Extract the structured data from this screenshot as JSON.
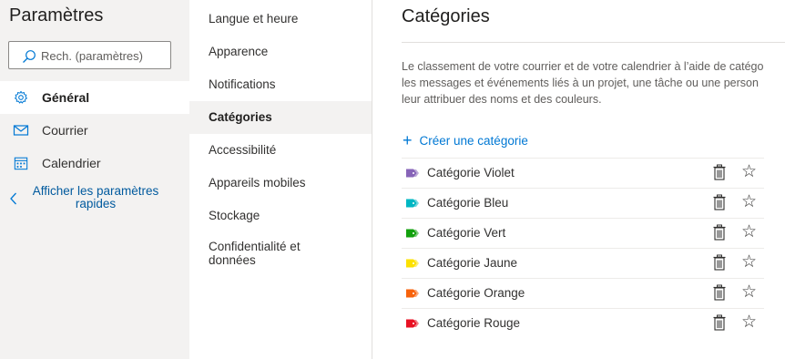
{
  "left": {
    "title": "Paramètres",
    "search_placeholder": "Rech. (paramètres)",
    "search_icon": "search-icon",
    "nav": [
      {
        "label": "Général",
        "icon": "gear-icon"
      },
      {
        "label": "Courrier",
        "icon": "mail-icon"
      },
      {
        "label": "Calendrier",
        "icon": "calendar-icon"
      }
    ],
    "quick_settings_label": "Afficher les paramètres rapides"
  },
  "middle": {
    "items": [
      {
        "label": "Langue et heure"
      },
      {
        "label": "Apparence"
      },
      {
        "label": "Notifications"
      },
      {
        "label": "Catégories"
      },
      {
        "label": "Accessibilité"
      },
      {
        "label": "Appareils mobiles"
      },
      {
        "label": "Stockage"
      },
      {
        "label": "Confidentialité et données"
      }
    ],
    "selected": "Catégories"
  },
  "main": {
    "title": "Catégories",
    "description_lines": [
      "Le classement de votre courrier et de votre calendrier à l’aide de catégo",
      "les messages et événements liés à un projet, une tâche ou une person",
      "leur attribuer des noms et des couleurs."
    ],
    "create_label": "Créer une catégorie",
    "categories": [
      {
        "name": "Catégorie Violet",
        "color": "#8764b8"
      },
      {
        "name": "Catégorie Bleu",
        "color": "#00b7c3"
      },
      {
        "name": "Catégorie Vert",
        "color": "#13a10e"
      },
      {
        "name": "Catégorie Jaune",
        "color": "#fce100"
      },
      {
        "name": "Catégorie Orange",
        "color": "#f7630c"
      },
      {
        "name": "Catégorie Rouge",
        "color": "#e81123"
      }
    ]
  },
  "colors": {
    "accent": "#0078d4",
    "link": "#005a9e",
    "left_pane_bg": "#f3f2f1",
    "selected_bg": "#f3f2f1"
  }
}
